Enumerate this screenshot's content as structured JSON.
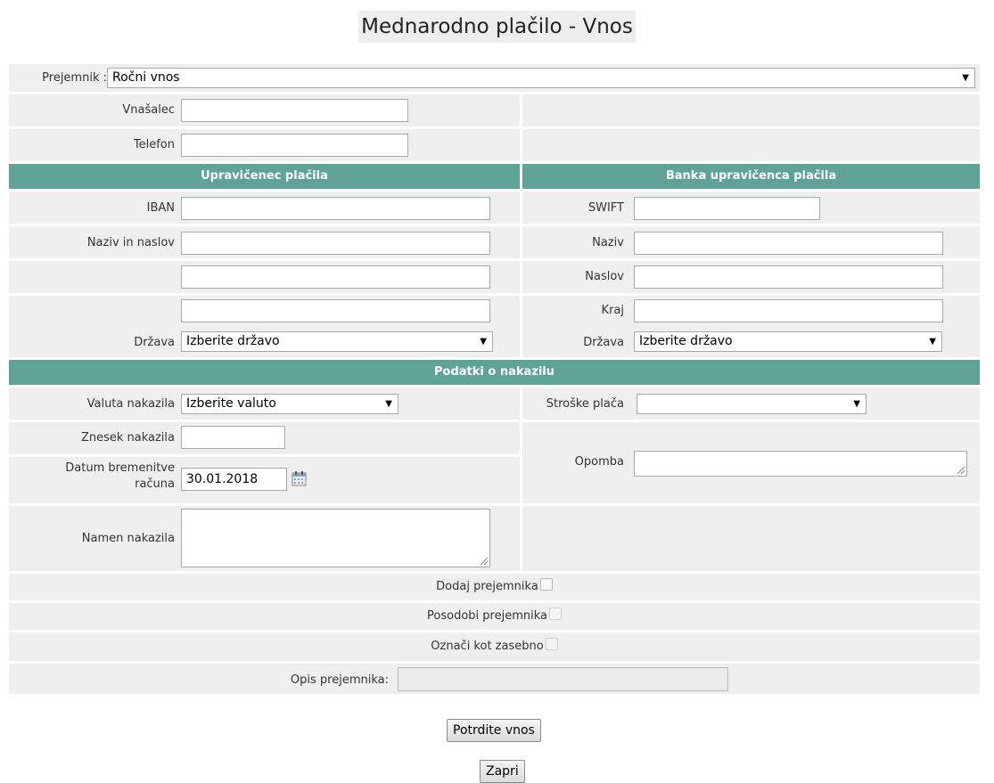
{
  "title": "Mednarodno plačilo - Vnos",
  "recipient": {
    "label": "Prejemnik :",
    "value": "Ročni vnos"
  },
  "submitter": {
    "label": "Vnašalec",
    "value": ""
  },
  "phone": {
    "label": "Telefon",
    "value": ""
  },
  "sections": {
    "beneficiary": "Upravičenec plačila",
    "bank": "Banka upravičenca plačila",
    "transfer": "Podatki o nakazilu"
  },
  "beneficiary": {
    "iban_label": "IBAN",
    "name_label": "Naziv in naslov",
    "country_label": "Država",
    "country_value": "Izberite državo"
  },
  "bank": {
    "swift_label": "SWIFT",
    "name_label": "Naziv",
    "address_label": "Naslov",
    "city_label": "Kraj",
    "country_label": "Država",
    "country_value": "Izberite državo"
  },
  "transfer": {
    "currency_label": "Valuta nakazila",
    "currency_value": "Izberite valuto",
    "costs_label": "Stroške plača",
    "costs_value": "",
    "amount_label": "Znesek nakazila",
    "amount_value": "",
    "date_label_1": "Datum bremenitve",
    "date_label_2": "računa",
    "date_value": "30.01.2018",
    "note_label": "Opomba",
    "purpose_label": "Namen nakazila"
  },
  "options": {
    "add_recipient": "Dodaj prejemnika",
    "update_recipient": "Posodobi prejemnika",
    "mark_private": "Označi kot zasebno",
    "description_label": "Opis prejemnika:"
  },
  "buttons": {
    "confirm": "Potrdite vnos",
    "close": "Zapri"
  }
}
